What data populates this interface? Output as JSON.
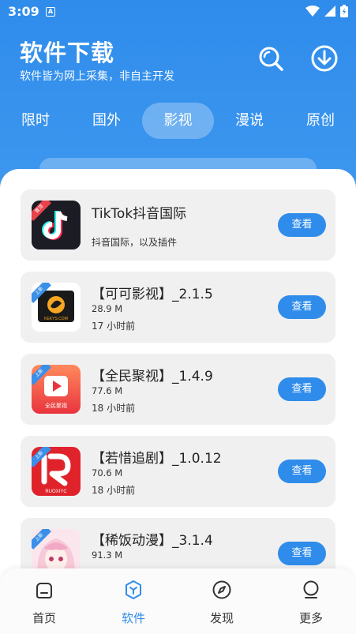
{
  "status": {
    "time": "3:09",
    "notif_icon": "A"
  },
  "header": {
    "title": "软件下载",
    "subtitle": "软件皆为网上采集，非自主开发"
  },
  "tabs": [
    {
      "label": "限时"
    },
    {
      "label": "国外"
    },
    {
      "label": "影视",
      "active": true
    },
    {
      "label": "漫说"
    },
    {
      "label": "原创"
    }
  ],
  "apps": [
    {
      "name": "TikTok抖音国际",
      "desc": "抖音国际，以及插件",
      "badge": "置顶",
      "button": "查看",
      "icon": "tiktok-logo"
    },
    {
      "name": "【可可影视】_2.1.5",
      "size": "28.9 M",
      "time": "17 小时前",
      "badge": "上新",
      "button": "查看",
      "icon": "kekeys-logo",
      "logo_text": "KEKYS.COM"
    },
    {
      "name": "【全民聚视】_1.4.9",
      "size": "77.6 M",
      "time": "18 小时前",
      "badge": "上新",
      "button": "查看",
      "icon": "quanmin-logo",
      "logo_text": "全民聚视"
    },
    {
      "name": "【若惜追剧】_1.0.12",
      "size": "70.6 M",
      "time": "18 小时前",
      "badge": "上新",
      "button": "查看",
      "icon": "ruoxi-logo",
      "logo_text": "RUOXIYC"
    },
    {
      "name": "【稀饭动漫】_3.1.4",
      "size": "91.3 M",
      "time": "",
      "badge": "上新",
      "button": "查看",
      "icon": "anime-girl-avatar"
    }
  ],
  "nav": [
    {
      "label": "首页",
      "icon": "home-icon"
    },
    {
      "label": "软件",
      "icon": "software-icon",
      "active": true
    },
    {
      "label": "发现",
      "icon": "compass-icon"
    },
    {
      "label": "更多",
      "icon": "more-icon"
    }
  ],
  "colors": {
    "primary": "#2F8CEB",
    "card_bg": "#F0F0F0",
    "badge_red": "#E8424A",
    "badge_blue": "#3A8FE8"
  }
}
